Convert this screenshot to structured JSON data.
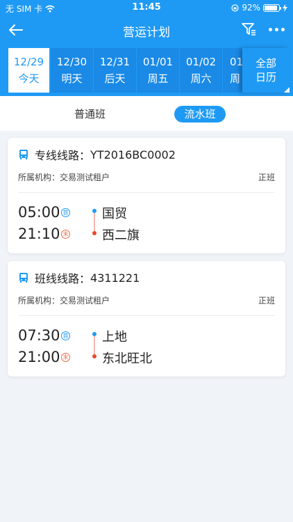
{
  "status_bar": {
    "carrier": "无 SIM 卡",
    "time": "11:45",
    "battery_pct_text": "92%",
    "battery_level": 0.92
  },
  "nav": {
    "title": "营运计划",
    "icons": [
      "back-arrow-icon",
      "filter-icon",
      "more-icon"
    ]
  },
  "dates": [
    {
      "date": "12/29",
      "day": "今天",
      "active": true
    },
    {
      "date": "12/30",
      "day": "明天",
      "active": false
    },
    {
      "date": "12/31",
      "day": "后天",
      "active": false
    },
    {
      "date": "01/01",
      "day": "周五",
      "active": false
    },
    {
      "date": "01/02",
      "day": "周六",
      "active": false
    },
    {
      "date": "01/",
      "day": "周",
      "active": false
    }
  ],
  "calendar_button": {
    "line1": "全部",
    "line2": "日历"
  },
  "tabs": {
    "normal": "普通班",
    "flow": "流水班",
    "selected": "flow"
  },
  "colors": {
    "primary": "#1f9af4",
    "start_dot": "#1f9af4",
    "end_dot": "#e84a2a"
  },
  "routes": [
    {
      "label": "专线线路：",
      "code": "YT2016BC0002",
      "org_label": "所属机构：",
      "org": "交易测试租户",
      "type": "正班",
      "start_time": "05:00",
      "start_tag": "首",
      "end_time": "21:10",
      "end_tag": "末",
      "from_station": "国贸",
      "to_station": "西二旗"
    },
    {
      "label": "班线线路：",
      "code": "4311221",
      "org_label": "所属机构：",
      "org": "交易测试租户",
      "type": "正班",
      "start_time": "07:30",
      "start_tag": "首",
      "end_time": "21:00",
      "end_tag": "末",
      "from_station": "上地",
      "to_station": "东北旺北"
    }
  ]
}
